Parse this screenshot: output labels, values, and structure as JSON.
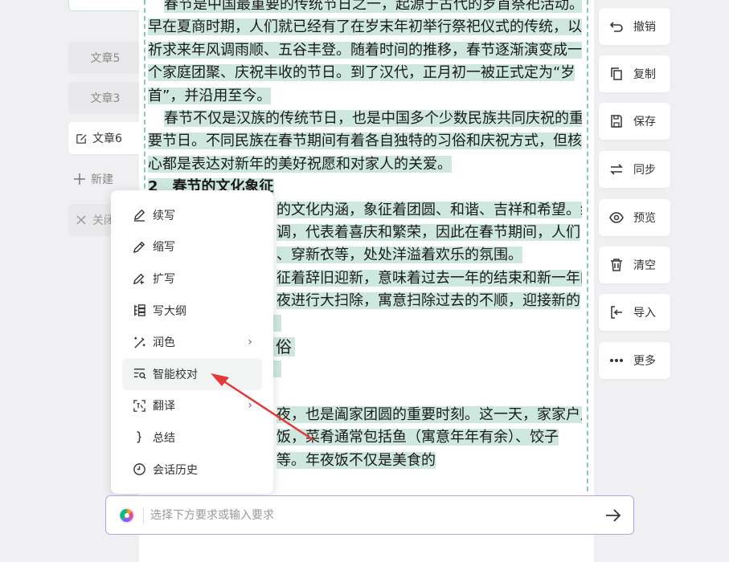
{
  "doc_tabs": [
    {
      "label": "文章5"
    },
    {
      "label": "文章3"
    },
    {
      "label": "文章6"
    }
  ],
  "new_tab_label": "新建",
  "close_tab_label": "关闭",
  "content_lines": [
    "春节是中国最重要的传统节日之一，起源于古代的岁首祭祀活动。",
    "早在夏商时期，人们就已经有了在岁末年初举行祭祀仪式的传统，以",
    "祈求来年风调雨顺、五谷丰登。随着时间的推移，春节逐渐演变成一",
    "个家庭团聚、庆祝丰收的节日。到了汉代，正月初一被正式定为“岁",
    "首”，并沿用至今。",
    "春节不仅是汉族的传统节日，也是中国多个少数民族共同庆祝的重",
    "要节日。不同民族在春节期间有着各自独特的习俗和庆祝方式，但核",
    "心都是表达对新年的美好祝愿和对家人的关爱。",
    "2　春节的文化象征",
    "的文化内涵，象征着团圆、和谐、吉祥和希望。红",
    "调，代表着喜庆和繁荣，因此在春节期间，人们",
    "、穿新衣等，处处洋溢着欢乐的氛围。",
    "征着辞旧迎新，意味着过去一年的结束和新一年的",
    "夜进行大扫除，寓意扫除过去的不顺，迎接新的",
    "俗",
    "夜，也是阖家团圆的重要时刻。这一天，家家户户",
    "饭，菜肴通常包括鱼（寓意年年有余）、饺子",
    "等。年夜饭不仅是美食的"
  ],
  "toolbar": [
    {
      "label": "撤销",
      "icon": "undo-icon"
    },
    {
      "label": "复制",
      "icon": "copy-icon"
    },
    {
      "label": "保存",
      "icon": "save-icon"
    },
    {
      "label": "同步",
      "icon": "sync-icon"
    },
    {
      "label": "预览",
      "icon": "eye-icon"
    },
    {
      "label": "清空",
      "icon": "trash-icon"
    },
    {
      "label": "导入",
      "icon": "import-icon"
    },
    {
      "label": "更多",
      "icon": "more-icon"
    }
  ],
  "menu": [
    {
      "label": "续写",
      "icon": "pen-icon"
    },
    {
      "label": "缩写",
      "icon": "pencil-icon"
    },
    {
      "label": "扩写",
      "icon": "pen-plus-icon"
    },
    {
      "label": "写大纲",
      "icon": "outline-icon"
    },
    {
      "label": "润色",
      "icon": "magic-wand-icon",
      "submenu": "›"
    },
    {
      "label": "智能校对",
      "icon": "proofread-icon"
    },
    {
      "label": "翻译",
      "icon": "translate-icon",
      "submenu": "›"
    },
    {
      "label": "总结",
      "icon": "brace-icon"
    },
    {
      "label": "会话历史",
      "icon": "clock-icon"
    }
  ],
  "input": {
    "placeholder": "选择下方要求或输入要求"
  },
  "colors": {
    "highlight": "#cfe8df",
    "dashed_border": "#88ccb0",
    "input_border": "#b7a3ea",
    "annotation_arrow": "#e53935"
  }
}
